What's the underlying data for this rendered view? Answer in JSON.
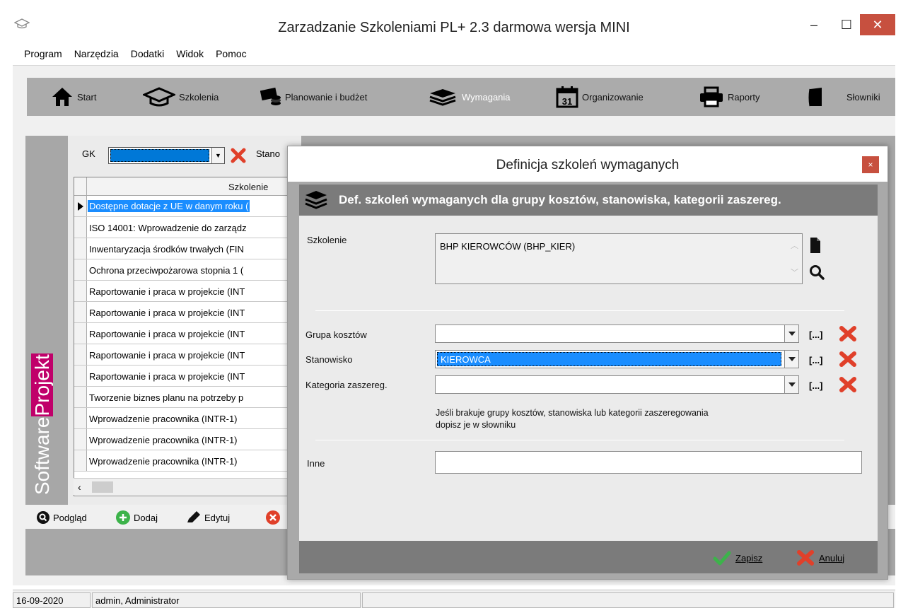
{
  "window": {
    "title": "Zarzadzanie Szkoleniami PL+ 2.3   darmowa wersja MINI",
    "min": "–",
    "max": "☐",
    "close": "✕"
  },
  "menu": [
    "Program",
    "Narzędzia",
    "Dodatki",
    "Widok",
    "Pomoc"
  ],
  "toolbar": {
    "start": "Start",
    "szkolenia": "Szkolenia",
    "planowanie": "Planowanie i budżet",
    "wymagania": "Wymagania",
    "organizowanie": "Organizowanie",
    "raporty": "Raporty",
    "slowniki": "Słowniki",
    "calendar_day": "31"
  },
  "brand": {
    "part1": "Software",
    "part2": "Projekt"
  },
  "filter": {
    "gk_label": "GK",
    "stano_label": "Stano"
  },
  "grid": {
    "header": "Szkolenie",
    "rows": [
      "Dostępne dotacje z UE w danym roku (",
      "ISO 14001: Wprowadzenie do zarządz",
      "Inwentaryzacja środków trwałych (FIN",
      "Ochrona przeciwpożarowa stopnia 1 (",
      "Raportowanie i praca w projekcie (INT",
      "Raportowanie i praca w projekcie (INT",
      "Raportowanie i praca w projekcie (INT",
      "Raportowanie i praca w projekcie (INT",
      "Raportowanie i praca w projekcie (INT",
      "Tworzenie biznes planu na potrzeby p",
      "Wprowadzenie pracownika (INTR-1)",
      "Wprowadzenie pracownika (INTR-1)",
      "Wprowadzenie pracownika (INTR-1)"
    ],
    "scroll_left": "‹"
  },
  "bottom": {
    "podglad": "Podgląd",
    "dodaj": "Dodaj",
    "edytuj": "Edytuj"
  },
  "status": {
    "date": "16-09-2020",
    "user": "admin, Administrator"
  },
  "dialog": {
    "title": "Definicja szkoleń wymaganych",
    "close": "×",
    "header": "Def. szkoleń wymaganych dla grupy kosztów, stanowiska, kategorii zaszereg.",
    "szkolenie_label": "Szkolenie",
    "szkolenie_value": "BHP KIEROWCÓW (BHP_KIER)",
    "grupa_label": "Grupa kosztów",
    "grupa_value": "",
    "stanowisko_label": "Stanowisko",
    "stanowisko_value": "KIEROWCA",
    "kategoria_label": "Kategoria zaszereg.",
    "kategoria_value": "",
    "ellipsis": "[...]",
    "info_line1": "Jeśli brakuje grupy kosztów, stanowiska lub kategorii zaszeregowania",
    "info_line2": "dopisz je w słowniku",
    "inne_label": "Inne",
    "inne_value": "",
    "zapisz": "Zapisz",
    "anuluj": "Anuluj"
  },
  "colors": {
    "accent": "#0078d7",
    "selection": "#1a8dff",
    "danger": "#e0402a",
    "ok": "#3cb34a",
    "brand": "#c0006a"
  }
}
